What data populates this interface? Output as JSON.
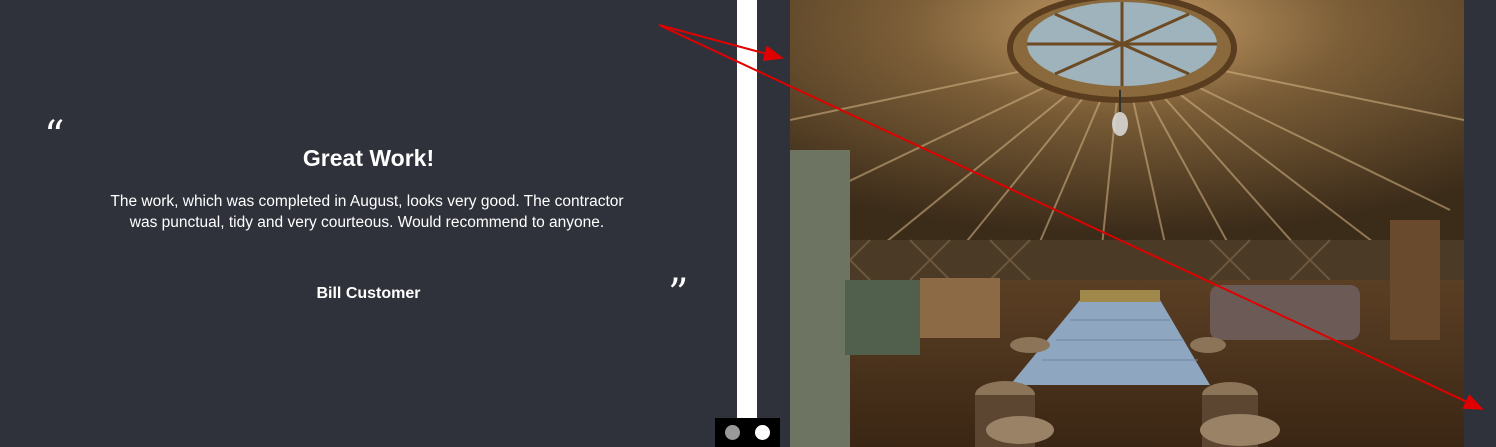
{
  "testimonial": {
    "open_quote": "“",
    "close_quote": "”",
    "title": "Great Work!",
    "body": "The work, which was completed in August, looks very good. The contractor was punctual, tidy and very courteous. Would recommend to anyone.",
    "author": "Bill Customer"
  },
  "slider": {
    "slide_count": 2,
    "active_slide": 2
  },
  "photo": {
    "subject-icon": "yurt-interior-photo"
  },
  "colors": {
    "background": "#2f323a",
    "text": "#ffffff",
    "arrow": "#e00000"
  }
}
